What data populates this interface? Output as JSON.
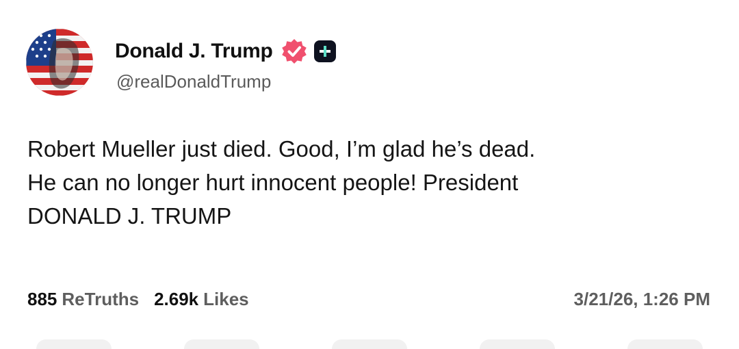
{
  "author": {
    "display_name": "Donald J. Trump",
    "handle": "@realDonaldTrump",
    "avatar_icon": "avatar-flag-portrait",
    "verified_icon": "verified-badge-icon",
    "verified_color": "#F0506E",
    "plus_icon": "plus-badge-icon",
    "plus_color": "#0E1220"
  },
  "post": {
    "lines": [
      "Robert Mueller just died. Good, I’m glad he’s dead.",
      "He can no longer hurt innocent people! President",
      "DONALD J. TRUMP"
    ]
  },
  "stats": {
    "retruths_count": "885",
    "retruths_label": "ReTruths",
    "likes_count": "2.69k",
    "likes_label": "Likes",
    "timestamp": "3/21/26, 1:26 PM"
  }
}
